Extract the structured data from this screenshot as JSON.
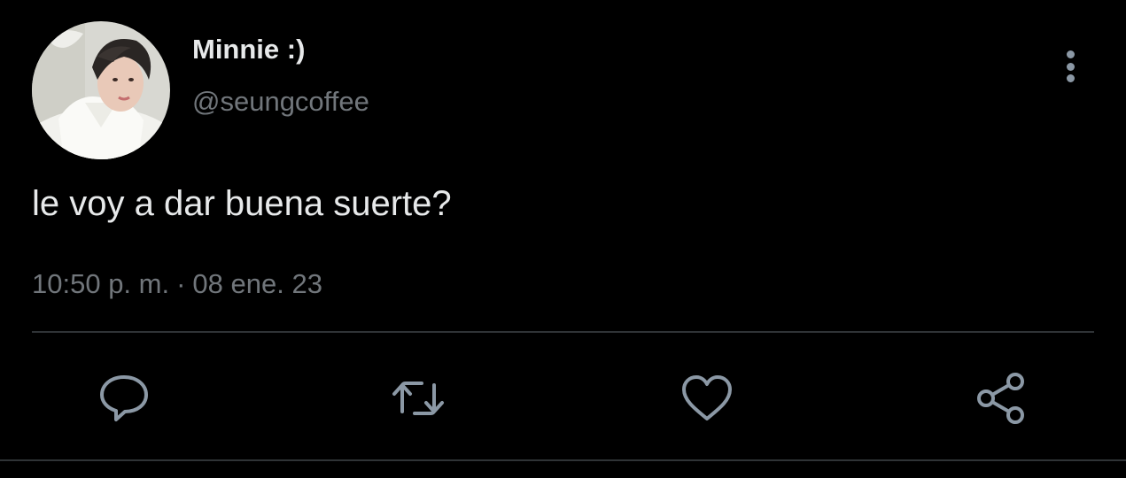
{
  "user": {
    "display_name": "Minnie :)",
    "handle": "@seungcoffee"
  },
  "tweet": {
    "text": "le voy a dar buena suerte?",
    "time": "10:50 p. m.",
    "separator": "·",
    "date": "08 ene. 23"
  },
  "actions": {
    "reply_icon": "reply-icon",
    "retweet_icon": "retweet-icon",
    "like_icon": "heart-icon",
    "share_icon": "share-icon"
  },
  "colors": {
    "background": "#000000",
    "primary_text": "#e7e9ea",
    "secondary_text": "#71767b",
    "icon": "#8b98a5",
    "divider": "#2f3336"
  }
}
